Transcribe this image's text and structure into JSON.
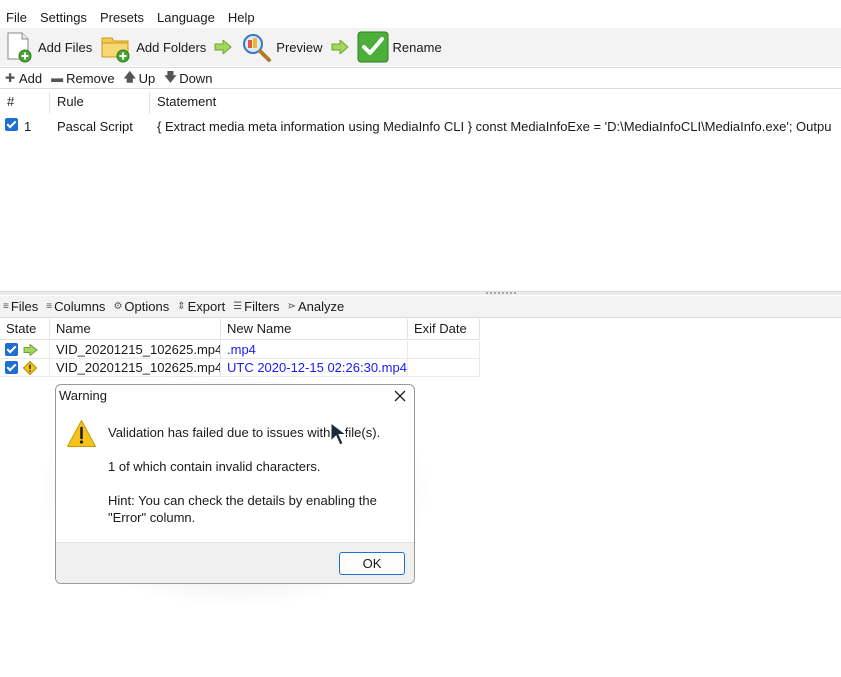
{
  "menu": [
    "File",
    "Settings",
    "Presets",
    "Language",
    "Help"
  ],
  "toolbar": {
    "add_files": "Add Files",
    "add_folders": "Add Folders",
    "preview": "Preview",
    "rename": "Rename"
  },
  "rules_toolbar": {
    "add": "Add",
    "remove": "Remove",
    "up": "Up",
    "down": "Down"
  },
  "rules_table": {
    "headers": [
      "#",
      "Rule",
      "Statement"
    ],
    "rows": [
      {
        "checked": true,
        "index": "1",
        "rule": "Pascal Script",
        "statement": "{ Extract media meta information using MediaInfo CLI } const MediaInfoExe = 'D:\\MediaInfoCLI\\MediaInfo.exe'; Outpu"
      }
    ]
  },
  "files_toolbar": {
    "files": "Files",
    "columns": "Columns",
    "options": "Options",
    "export": "Export",
    "filters": "Filters",
    "analyze": "Analyze"
  },
  "files_table": {
    "headers": [
      "State",
      "Name",
      "New Name",
      "Exif Date"
    ],
    "rows": [
      {
        "checked": true,
        "state_icon": "green-arrow-icon",
        "name": "VID_20201215_102625.mp4",
        "new_name": ".mp4",
        "exif_date": ""
      },
      {
        "checked": true,
        "state_icon": "warning-icon",
        "name": "VID_20201215_102625.mp4",
        "new_name": "UTC 2020-12-15 02:26:30.mp4",
        "exif_date": ""
      }
    ]
  },
  "dialog": {
    "title": "Warning",
    "line1": "Validation has failed due to issues with 1 file(s).",
    "line2": "1 of which contain invalid characters.",
    "line3": "Hint: You can check the details by enabling the \"Error\" column.",
    "ok": "OK"
  },
  "colors": {
    "accent": "#1f6fd1",
    "new_name_text": "#1a1aff",
    "toolbar_bg": "#f3f3f3",
    "warning": "#f6c21c"
  }
}
